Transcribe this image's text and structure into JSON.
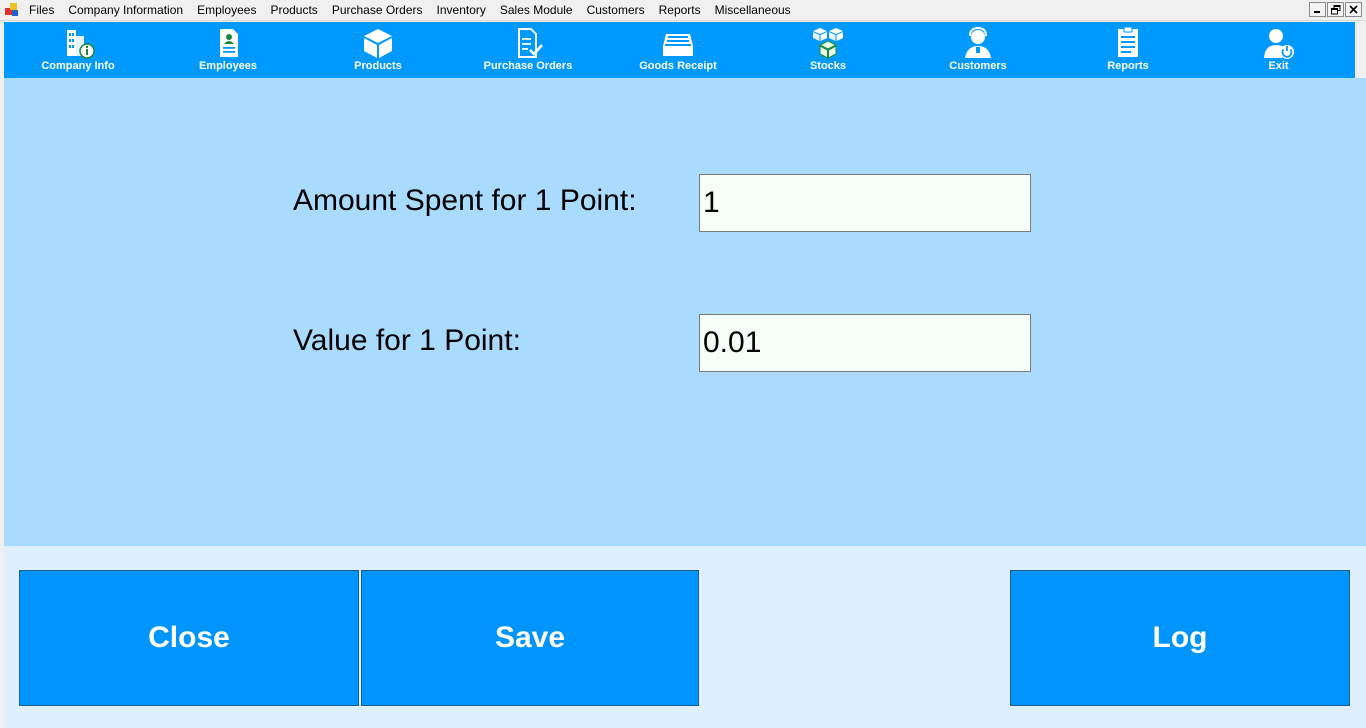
{
  "menu": {
    "items": [
      "Files",
      "Company Information",
      "Employees",
      "Products",
      "Purchase Orders",
      "Inventory",
      "Sales Module",
      "Customers",
      "Reports",
      "Miscellaneous"
    ]
  },
  "window_controls": [
    "minimize-icon",
    "restore-icon",
    "close-icon"
  ],
  "toolbar": {
    "items": [
      {
        "label": "Company Info",
        "icon": "building-info-icon"
      },
      {
        "label": "Employees",
        "icon": "employee-document-icon"
      },
      {
        "label": "Products",
        "icon": "box-icon"
      },
      {
        "label": "Purchase Orders",
        "icon": "checklist-document-icon"
      },
      {
        "label": "Goods Receipt",
        "icon": "inbox-tray-icon"
      },
      {
        "label": "Stocks",
        "icon": "stacked-boxes-icon"
      },
      {
        "label": "Customers",
        "icon": "customer-headset-icon"
      },
      {
        "label": "Reports",
        "icon": "report-clipboard-icon"
      },
      {
        "label": "Exit",
        "icon": "user-power-icon"
      }
    ]
  },
  "form": {
    "amount_label": "Amount Spent for 1 Point:",
    "amount_value": "1",
    "value_label": "Value for 1 Point:",
    "value_value": "0.01"
  },
  "actions": {
    "close_label": "Close",
    "save_label": "Save",
    "log_label": "Log"
  },
  "colors": {
    "toolbar": "#0099ff",
    "main_panel": "#a9dbff",
    "bottom_panel": "#deefff",
    "action_button": "#0094ff",
    "input_background": "#f5fff7"
  }
}
